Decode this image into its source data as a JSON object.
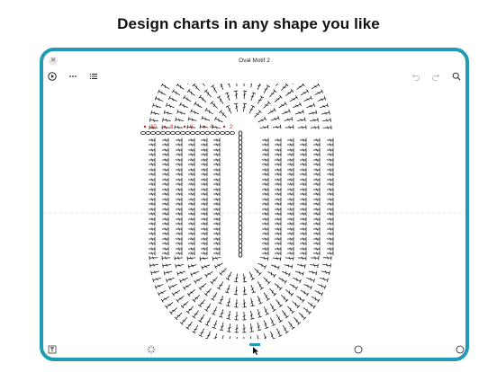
{
  "headline": "Design charts in any shape you like",
  "document": {
    "title": "Oval Motif 2"
  },
  "titlebar": {
    "close_icon": "close-icon"
  },
  "toolbar": {
    "left": [
      "play-icon",
      "more-icon",
      "list-icon"
    ],
    "right": [
      "undo-icon",
      "redo-icon",
      "zoom-icon"
    ]
  },
  "chart": {
    "row_numbers": [
      "10",
      "8",
      "6",
      "4",
      "2"
    ],
    "stitch_color": "#111111",
    "marker_color": "#d21f1f"
  },
  "bottombar": [
    "text-tool-icon",
    "loading-icon",
    "select-tool-icon",
    "circle-icon",
    "circle-icon"
  ],
  "colors": {
    "accent": "#1f9bb8",
    "frame": "#1f9bb8"
  }
}
